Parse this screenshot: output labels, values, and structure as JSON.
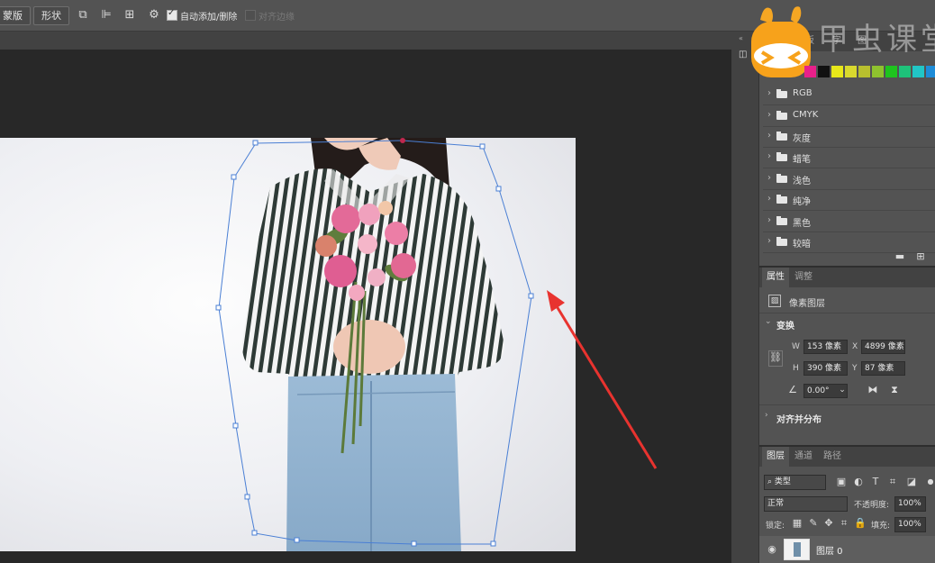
{
  "options_bar": {
    "mask_label": "蒙版",
    "shape_label": "形状",
    "auto_add_delete_label": "自动添加/删除",
    "auto_add_delete_checked": true,
    "align_edges_label": "对齐边缘",
    "align_edges_checked": false
  },
  "watermark": {
    "text": "甲虫课堂"
  },
  "swatches_panel": {
    "tabs": [
      "板",
      "字",
      "图"
    ],
    "colors": [
      "#e8208a",
      "#111111",
      "#e8e81a",
      "#d9d92e",
      "#b8bf2e",
      "#8fc22e",
      "#1ec41e",
      "#1ec27a",
      "#21c6c6",
      "#1e8cd8",
      "#2f5fd8"
    ],
    "groups": [
      {
        "label": "RGB"
      },
      {
        "label": "CMYK"
      },
      {
        "label": "灰度"
      },
      {
        "label": "蜡笔"
      },
      {
        "label": "浅色"
      },
      {
        "label": "纯净"
      },
      {
        "label": "黑色"
      },
      {
        "label": "较暗"
      }
    ]
  },
  "properties_panel": {
    "tabs": [
      "属性",
      "调整"
    ],
    "type_label": "像素图层",
    "transform_label": "变换",
    "w_label": "W",
    "w_value": "153 像素",
    "x_label": "X",
    "x_value": "4899 像素",
    "h_label": "H",
    "h_value": "390 像素",
    "y_label": "Y",
    "y_value": "87 像素",
    "angle_value": "0.00°",
    "align_label": "对齐并分布"
  },
  "layers_panel": {
    "tabs": [
      "图层",
      "通道",
      "路径"
    ],
    "filter_label": "类型",
    "blend_mode": "正常",
    "opacity_label": "不透明度:",
    "opacity_value": "100%",
    "lock_label": "锁定:",
    "fill_label": "填充:",
    "fill_value": "100%",
    "layers": [
      {
        "name": "图层 0",
        "visible": true
      }
    ]
  },
  "colors": {
    "path_stroke": "#4a7fd4",
    "arrow": "#e8332f",
    "panel_bg": "#535353",
    "workspace_bg": "#282828"
  }
}
